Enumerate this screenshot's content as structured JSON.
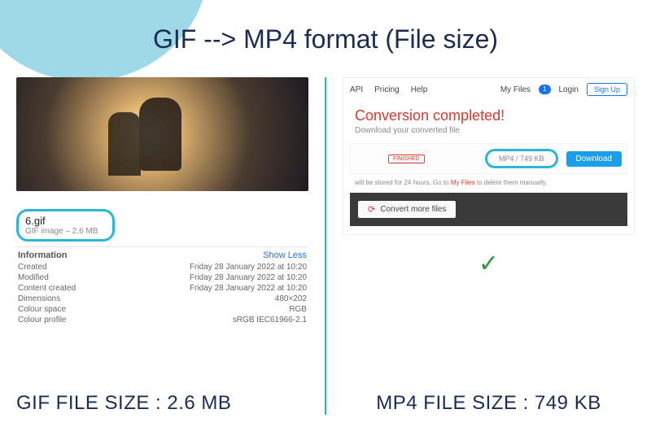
{
  "title": "GIF --> MP4 format (File size)",
  "left": {
    "filename": "6.gif",
    "filetype_size": "GIF image – 2,6 MB",
    "info_header": "Information",
    "show_less": "Show Less",
    "rows": [
      {
        "k": "Created",
        "v": "Friday 28 January 2022 at 10:20"
      },
      {
        "k": "Modified",
        "v": "Friday 28 January 2022 at 10:20"
      },
      {
        "k": "Content created",
        "v": "Friday 28 January 2022 at 10:20"
      },
      {
        "k": "Dimensions",
        "v": "480×202"
      },
      {
        "k": "Colour space",
        "v": "RGB"
      },
      {
        "k": "Colour profile",
        "v": "sRGB IEC61966-2.1"
      }
    ],
    "caption": "GIF FILE SIZE : 2.6 MB"
  },
  "right": {
    "nav": {
      "api": "API",
      "pricing": "Pricing",
      "help": "Help",
      "myfiles": "My Files",
      "badge": "1",
      "login": "Login",
      "signup": "Sign Up"
    },
    "conv_title": "Conversion completed!",
    "conv_sub": "Download your converted file",
    "finished": "FINISHED",
    "result": "MP4 / 749 KB",
    "download": "Download",
    "store_pre": "will be stored for 24 hours. Go to ",
    "store_link": "My Files",
    "store_post": " to delete them manually.",
    "convert_more": "Convert more files",
    "caption": "MP4 FILE SIZE : 749 KB"
  }
}
